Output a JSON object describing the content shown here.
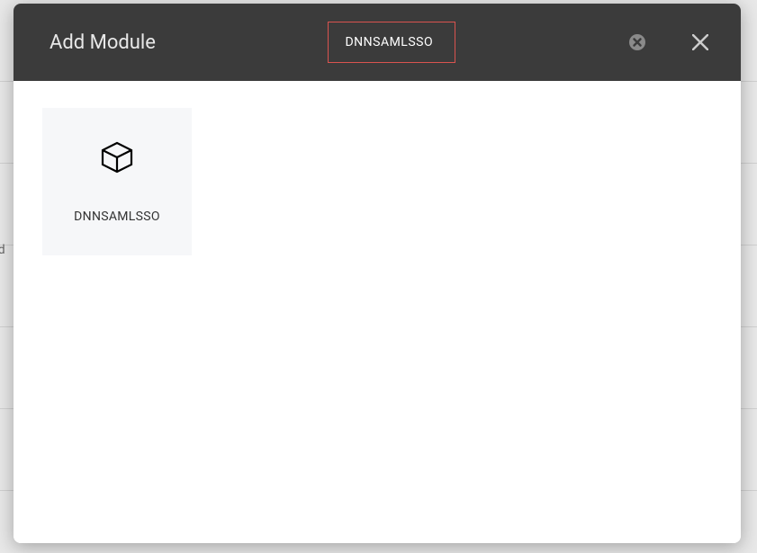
{
  "background": {
    "partial_text": "nd"
  },
  "modal": {
    "title": "Add Module",
    "search_value": "DNNSAMLSSO"
  },
  "modules": [
    {
      "label": "DNNSAMLSSO"
    }
  ]
}
